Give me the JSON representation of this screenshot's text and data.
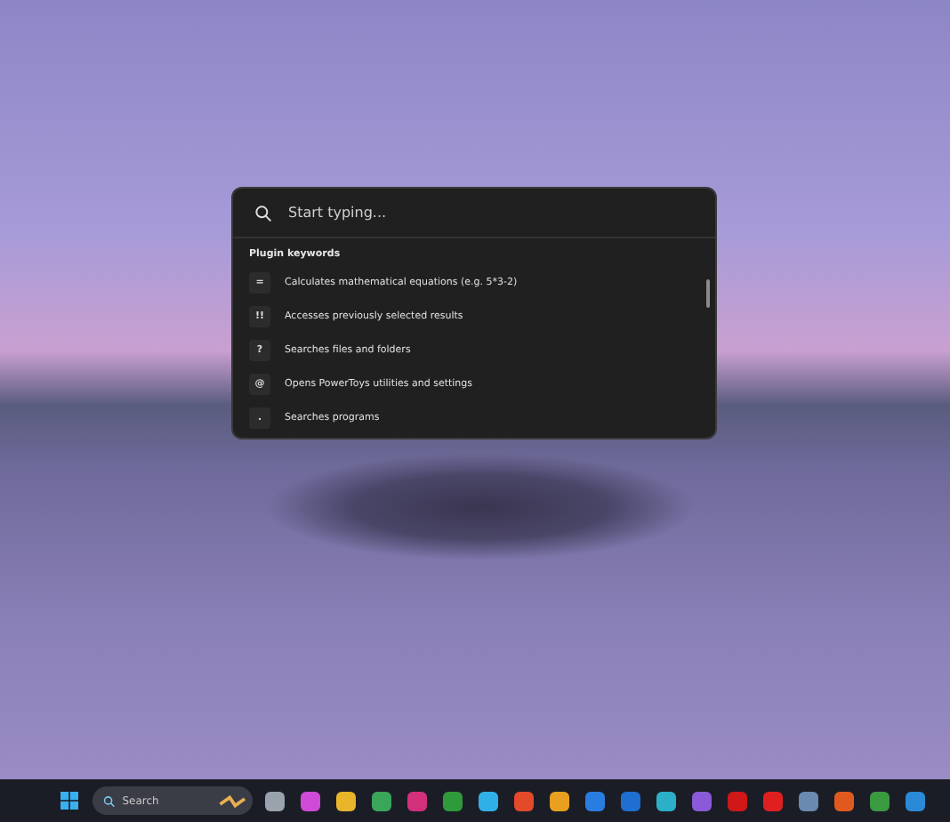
{
  "launcher": {
    "search": {
      "placeholder": "Start typing..."
    },
    "section_title": "Plugin keywords",
    "results": [
      {
        "key": "=",
        "description": "Calculates mathematical equations (e.g. 5*3-2)"
      },
      {
        "key": "!!",
        "description": "Accesses previously selected results"
      },
      {
        "key": "?",
        "description": "Searches files and folders"
      },
      {
        "key": "@",
        "description": "Opens PowerToys utilities and settings"
      },
      {
        "key": ".",
        "description": "Searches programs"
      }
    ]
  },
  "taskbar": {
    "search": {
      "placeholder": "Search"
    }
  }
}
